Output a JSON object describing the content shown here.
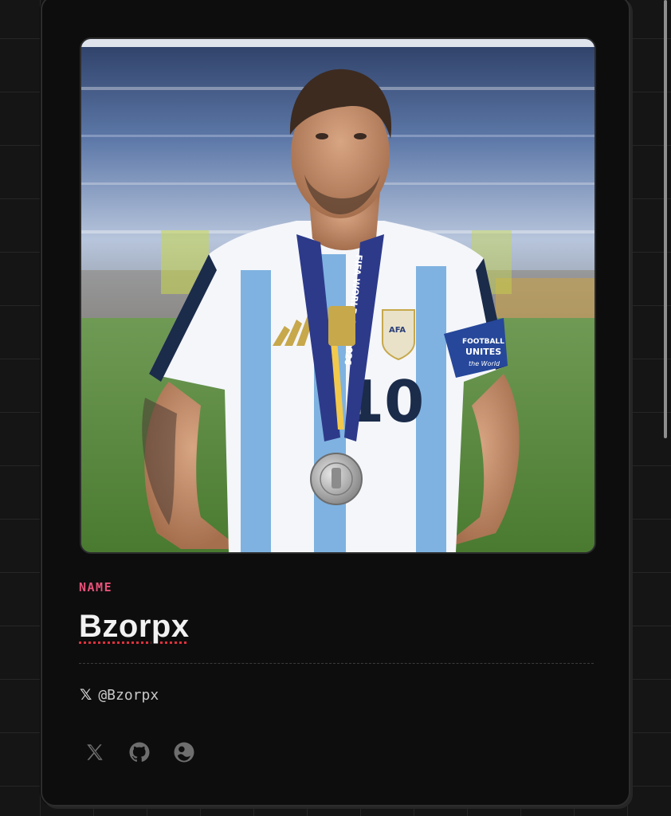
{
  "profile": {
    "photo_alt": "Profile photo",
    "name_label": "NAME",
    "name": "Bzorpx",
    "handle": "@Bzorpx",
    "handle_icon": "x-logo-icon"
  },
  "socials": [
    {
      "name": "x-social",
      "icon": "x-logo-icon"
    },
    {
      "name": "github-social",
      "icon": "github-icon"
    },
    {
      "name": "third-social",
      "icon": "profile-circle-icon"
    }
  ],
  "photo_text": {
    "medal_ribbon": "FIFA WORLD CUP 2026",
    "crest": "AFA",
    "number": "10",
    "armband_line1": "FOOTBALL",
    "armband_line2": "UNITES",
    "armband_line3": "the World"
  },
  "colors": {
    "accent_pink": "#e8527a",
    "underline_red": "#e0303c",
    "card_bg": "#0d0d0d",
    "page_bg": "#151515"
  }
}
